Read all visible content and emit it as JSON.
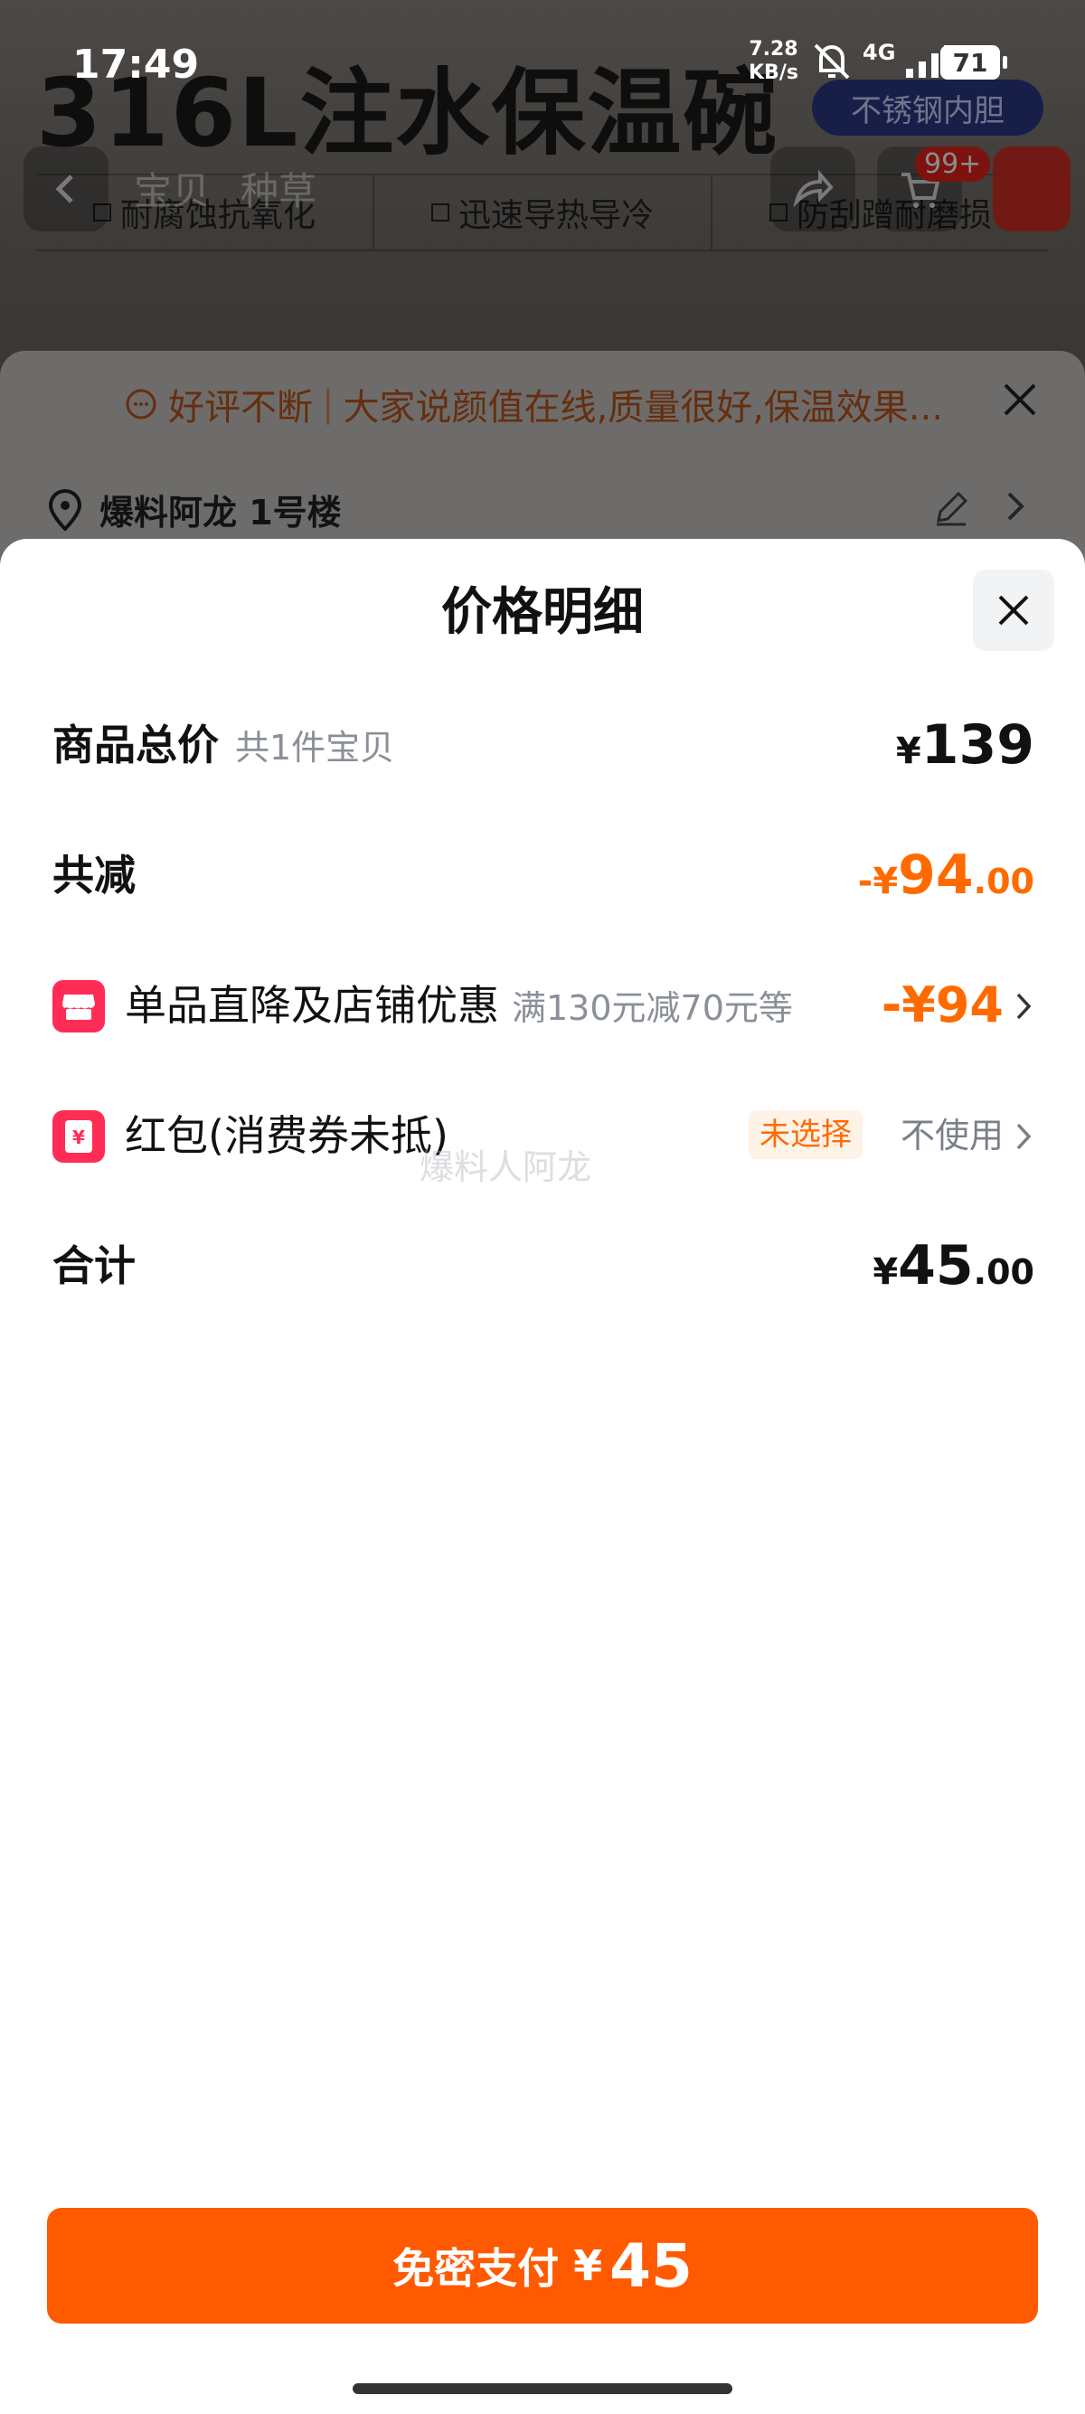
{
  "status_bar": {
    "time": "17:49",
    "speed_value": "7.28",
    "speed_unit": "KB/s",
    "network": "4G",
    "battery": "71"
  },
  "background_page": {
    "product_title": "316L注水保温碗",
    "spec_pill": "不锈钢内胆",
    "tabs": [
      "宝贝",
      "种草"
    ],
    "cart_badge": "99+",
    "features": [
      "耐腐蚀抗氧化",
      "迅速导热导冷",
      "防刮蹭耐磨损"
    ],
    "review_tag": "好评不断",
    "review_text": "大家说颜值在线,质量很好,保温效果...",
    "address": "爆料阿龙 1号楼"
  },
  "sheet": {
    "title": "价格明细",
    "rows": {
      "total": {
        "label": "商品总价",
        "sub": "共1件宝贝",
        "yen": "¥",
        "amount": "139"
      },
      "reduction": {
        "label": "共减",
        "sign": "-",
        "yen": "¥",
        "amount": "94",
        "decimal": ".00"
      },
      "discount": {
        "label": "单品直降及店铺优惠",
        "sub": "满130元减70元等",
        "value": "-¥94"
      },
      "red_packet": {
        "label": "红包(消费券未抵)",
        "tag": "未选择",
        "status": "不使用"
      },
      "sum": {
        "label": "合计",
        "yen": "¥",
        "amount": "45",
        "decimal": ".00"
      }
    },
    "watermark": "爆料人阿龙"
  },
  "pay_button": {
    "label": "免密支付",
    "yen": "¥",
    "amount": "45"
  },
  "colors": {
    "accent": "#ff5a00",
    "price_orange": "#ff6a00",
    "icon_red": "#ff2c55"
  }
}
